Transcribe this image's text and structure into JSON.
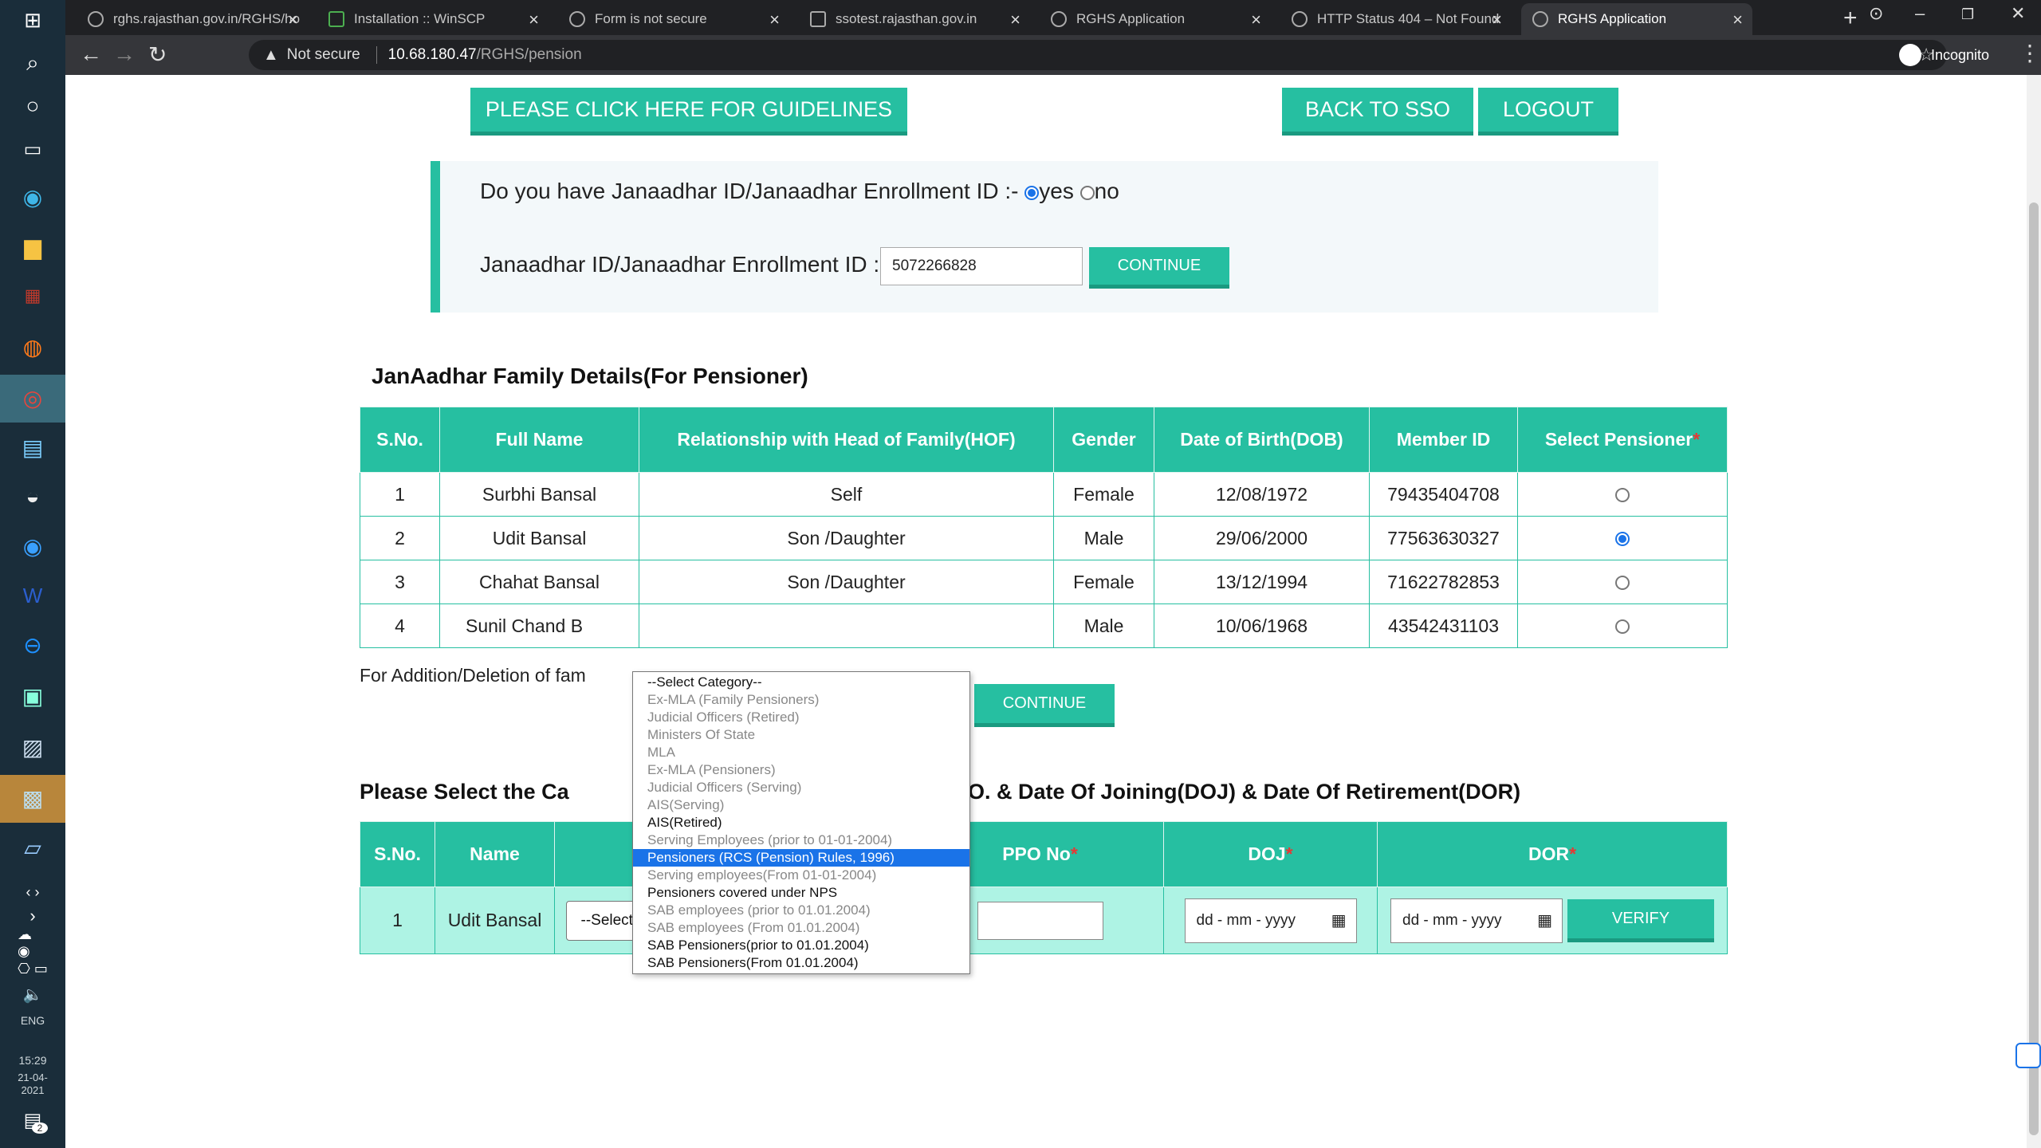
{
  "browser": {
    "tabs": [
      {
        "title": "rghs.rajasthan.gov.in/RGHS/ho"
      },
      {
        "title": "Installation :: WinSCP"
      },
      {
        "title": "Form is not secure"
      },
      {
        "title": "ssotest.rajasthan.gov.in"
      },
      {
        "title": "RGHS Application"
      },
      {
        "title": "HTTP Status 404 – Not Found"
      },
      {
        "title": "RGHS Application"
      }
    ],
    "security_label": "Not secure",
    "url_host": "10.68.180.47",
    "url_path": "/RGHS/pension",
    "incognito_label": "Incognito"
  },
  "taskbar": {
    "language": "ENG",
    "time": "15:29",
    "date": "21-04-2021",
    "notification_count": "2"
  },
  "header": {
    "guidelines_button": "PLEASE CLICK HERE FOR GUIDELINES",
    "back_button": "BACK TO SSO",
    "logout_button": "LOGOUT"
  },
  "janaadhar": {
    "question": "Do you have Janaadhar ID/Janaadhar Enrollment ID :-",
    "yes_label": "yes",
    "no_label": "no",
    "id_label": "Janaadhar ID/Janaadhar Enrollment ID : -",
    "id_value": "5072266828",
    "continue_button": "CONTINUE"
  },
  "family": {
    "title": "JanAadhar Family Details(For Pensioner)",
    "headers": [
      "S.No.",
      "Full Name",
      "Relationship with Head of Family(HOF)",
      "Gender",
      "Date of Birth(DOB)",
      "Member ID",
      "Select Pensioner"
    ],
    "rows": [
      {
        "sno": "1",
        "name": "Surbhi Bansal",
        "relation": "Self",
        "gender": "Female",
        "dob": "12/08/1972",
        "member_id": "79435404708"
      },
      {
        "sno": "2",
        "name": "Udit Bansal",
        "relation": "Son /Daughter",
        "gender": "Male",
        "dob": "29/06/2000",
        "member_id": "77563630327"
      },
      {
        "sno": "3",
        "name": "Chahat Bansal",
        "relation": "Son /Daughter",
        "gender": "Female",
        "dob": "13/12/1994",
        "member_id": "71622782853"
      },
      {
        "sno": "4",
        "name": "Sunil Chand B",
        "relation": "",
        "gender": "Male",
        "dob": "10/06/1968",
        "member_id": "43542431103"
      }
    ],
    "note": "For Addition/Deletion of fam",
    "continue_button": "CONTINUE"
  },
  "category": {
    "title_left": "Please Select the Ca",
    "title_right": "PPO NO. & Date Of Joining(DOJ) & Date Of Retirement(DOR)",
    "headers": {
      "sno": "S.No.",
      "name": "Name",
      "ppo": "PPO No",
      "doj": "DOJ",
      "dor": "DOR"
    },
    "row": {
      "sno": "1",
      "name": "Udit Bansal",
      "category": "--Select Category--"
    },
    "date_placeholder": "dd - mm - yyyy",
    "verify_button": "VERIFY",
    "options": [
      {
        "label": "--Select Category--",
        "state": "enabled"
      },
      {
        "label": "Ex-MLA (Family Pensioners)",
        "state": "disabled"
      },
      {
        "label": "Judicial Officers (Retired)",
        "state": "disabled"
      },
      {
        "label": "Ministers Of State",
        "state": "disabled"
      },
      {
        "label": "MLA",
        "state": "disabled"
      },
      {
        "label": "Ex-MLA (Pensioners)",
        "state": "disabled"
      },
      {
        "label": "Judicial Officers (Serving)",
        "state": "disabled"
      },
      {
        "label": "AIS(Serving)",
        "state": "disabled"
      },
      {
        "label": "AIS(Retired)",
        "state": "enabled"
      },
      {
        "label": "Serving Employees (prior to 01-01-2004)",
        "state": "disabled"
      },
      {
        "label": "Pensioners (RCS (Pension) Rules, 1996)",
        "state": "selected"
      },
      {
        "label": "Serving employees(From 01-01-2004)",
        "state": "disabled"
      },
      {
        "label": "Pensioners covered under NPS",
        "state": "enabled"
      },
      {
        "label": "SAB employees (prior to 01.01.2004)",
        "state": "disabled"
      },
      {
        "label": "SAB employees (From 01.01.2004)",
        "state": "disabled"
      },
      {
        "label": "SAB Pensioners(prior to 01.01.2004)",
        "state": "enabled"
      },
      {
        "label": "SAB Pensioners(From 01.01.2004)",
        "state": "enabled"
      }
    ]
  },
  "colors": {
    "accent": "#26bfa1",
    "row_bg": "#aef3e4",
    "required": "#e53935"
  }
}
